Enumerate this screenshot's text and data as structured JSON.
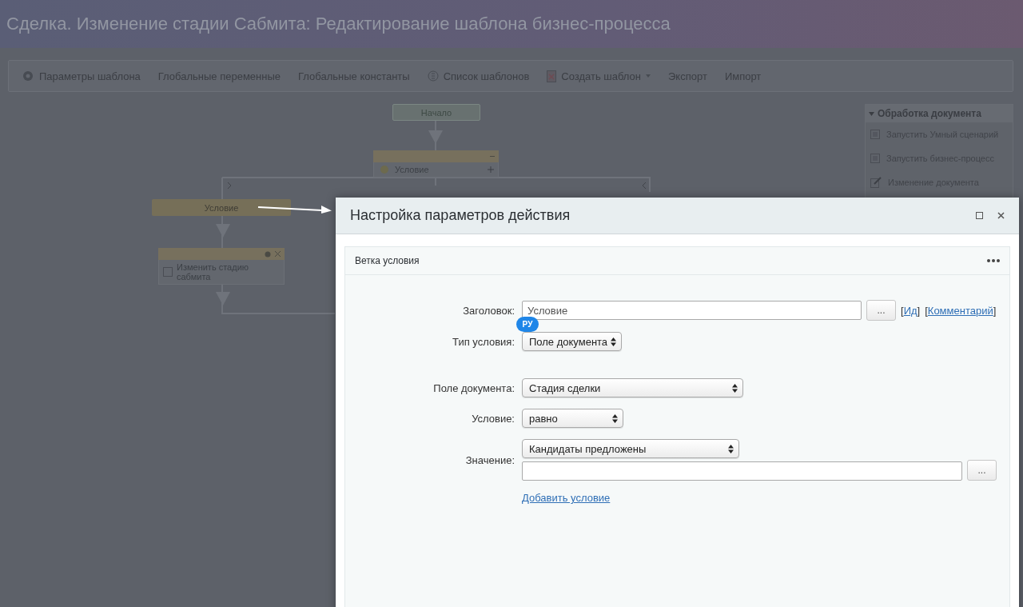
{
  "window": {
    "title": "Сделка. Изменение стадии Сабмита: Редактирование шаблона бизнес-процесса"
  },
  "toolbar": [
    {
      "label": "Параметры шаблона",
      "kind": "gear"
    },
    {
      "label": "Глобальные переменные",
      "kind": "plain"
    },
    {
      "label": "Глобальные константы",
      "kind": "plain"
    },
    {
      "label": "Список шаблонов",
      "kind": "list"
    },
    {
      "label": "Создать шаблон",
      "kind": "menu"
    },
    {
      "label": "Экспорт",
      "kind": "plain"
    },
    {
      "label": "Импорт",
      "kind": "plain"
    }
  ],
  "diagram": {
    "start": {
      "label": "Начало"
    },
    "condition": {
      "label": "Условие"
    },
    "branch": {
      "label": "Условие"
    },
    "activity": {
      "label": "Изменить стадию сабмита"
    }
  },
  "side_panel": {
    "title": "Обработка документа",
    "expanded": true,
    "items": [
      {
        "label": "Запустить Умный сценарий",
        "kind": "script"
      },
      {
        "label": "Запустить бизнес-процесс",
        "kind": "script"
      },
      {
        "label": "Изменение документа",
        "kind": "edit"
      }
    ]
  },
  "dialog": {
    "title": "Настройка параметров действия",
    "section": {
      "title": "Ветка условия",
      "title_field": {
        "label": "Заголовок:",
        "value": "Условие",
        "badge": "РУ",
        "button": "...",
        "links": [
          {
            "before": "[",
            "label": "Ид",
            "after": "]"
          },
          {
            "before": "[",
            "label": "Комментарий",
            "after": "]"
          }
        ]
      },
      "type_field": {
        "label": "Тип условия:",
        "value": "Поле документа"
      },
      "condition_fields": [
        {
          "label": "Поле документа:",
          "kind": "select",
          "value": "Стадия сделки"
        },
        {
          "label": "Условие:",
          "kind": "select",
          "value": "равно"
        },
        {
          "label": "Значение:",
          "kind": "value",
          "value": "Кандидаты предложены",
          "button": "..."
        }
      ],
      "add_link": "Добавить условие"
    }
  }
}
